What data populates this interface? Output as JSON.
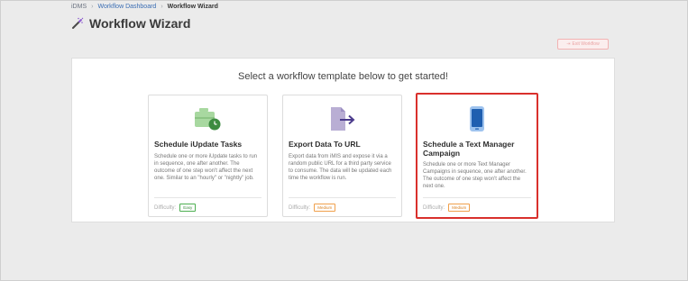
{
  "breadcrumb": {
    "root": "iDMS",
    "parent": "Workflow Dashboard",
    "current": "Workflow Wizard"
  },
  "page": {
    "title": "Workflow Wizard",
    "title_icon": "magic-wand-icon"
  },
  "exit_button": {
    "label": "Exit Workflow",
    "icon": "exit-icon"
  },
  "panel": {
    "heading": "Select a workflow template below to get started!"
  },
  "cards": [
    {
      "icon": "briefcase-clock-icon",
      "title": "Schedule iUpdate Tasks",
      "description": "Schedule one or more iUpdate tasks to run in sequence, one after another. The outcome of one step won't affect the next one. Similar to an \"hourly\" or \"nightly\" job.",
      "difficulty_label": "Difficulty:",
      "difficulty": "Easy",
      "selected": false
    },
    {
      "icon": "file-export-icon",
      "title": "Export Data To URL",
      "description": "Export data from iMIS and expose it via a random public URL for a third party service to consume. The data will be updated each time the workflow is run.",
      "difficulty_label": "Difficulty:",
      "difficulty": "Medium",
      "selected": false
    },
    {
      "icon": "mobile-phone-icon",
      "title": "Schedule a Text Manager Campaign",
      "description": "Schedule one or more Text Manager Campaigns in sequence, one after another. The outcome of one step won't affect the next one.",
      "difficulty_label": "Difficulty:",
      "difficulty": "Medium",
      "selected": true
    }
  ],
  "colors": {
    "selected_border": "#d9302c",
    "easy": "#4caf50",
    "medium": "#f0a04b",
    "link": "#3a6db3"
  }
}
